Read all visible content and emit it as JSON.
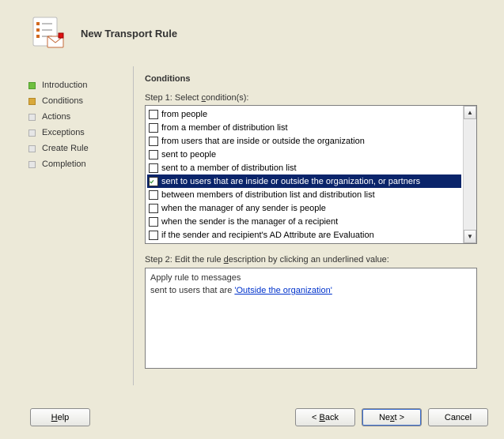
{
  "header": {
    "title": "New Transport Rule"
  },
  "sidebar": {
    "items": [
      {
        "label": "Introduction",
        "state": "done"
      },
      {
        "label": "Conditions",
        "state": "current"
      },
      {
        "label": "Actions",
        "state": "upcoming"
      },
      {
        "label": "Exceptions",
        "state": "upcoming"
      },
      {
        "label": "Create Rule",
        "state": "upcoming"
      },
      {
        "label": "Completion",
        "state": "upcoming"
      }
    ]
  },
  "content": {
    "section_title": "Conditions",
    "step1_prefix": "Step 1: Select ",
    "step1_u": "c",
    "step1_suffix": "ondition(s):",
    "step2_prefix": "Step 2: Edit the rule ",
    "step2_u": "d",
    "step2_suffix": "escription by clicking an underlined value:",
    "conditions": [
      {
        "label": "from people",
        "checked": false,
        "selected": false
      },
      {
        "label": "from a member of distribution list",
        "checked": false,
        "selected": false
      },
      {
        "label": "from users that are inside or outside the organization",
        "checked": false,
        "selected": false
      },
      {
        "label": "sent to people",
        "checked": false,
        "selected": false
      },
      {
        "label": "sent to a member of distribution list",
        "checked": false,
        "selected": false
      },
      {
        "label": "sent to users that are inside or outside the organization, or partners",
        "checked": true,
        "selected": true
      },
      {
        "label": "between members of distribution list and distribution list",
        "checked": false,
        "selected": false
      },
      {
        "label": "when the manager of any sender is people",
        "checked": false,
        "selected": false
      },
      {
        "label": "when the sender is the manager of a recipient",
        "checked": false,
        "selected": false
      },
      {
        "label": "if the sender and recipient's AD Attribute are Evaluation",
        "checked": false,
        "selected": false
      }
    ],
    "description": {
      "line1": "Apply rule to messages",
      "line2_prefix": "sent to users that are ",
      "link_text": "'Outside the organization'"
    }
  },
  "buttons": {
    "help": "Help",
    "back_u": "B",
    "back_rest": "ack",
    "next_pre": "Ne",
    "next_u": "x",
    "next_post": "t >",
    "cancel": "Cancel"
  }
}
